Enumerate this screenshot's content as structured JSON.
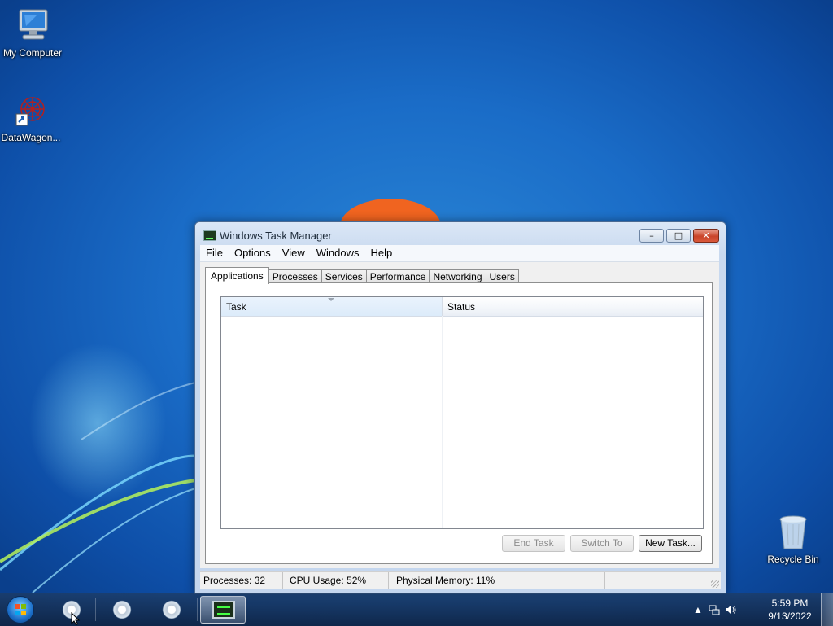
{
  "desktop": {
    "icons": [
      {
        "label": "My Computer"
      },
      {
        "label": "DataWagon..."
      },
      {
        "label": "Recycle Bin"
      }
    ]
  },
  "window": {
    "title": "Windows Task Manager",
    "controls": {
      "minimize": "–",
      "maximize": "□",
      "close": "✕"
    },
    "menu": [
      "File",
      "Options",
      "View",
      "Windows",
      "Help"
    ],
    "tabs": [
      "Applications",
      "Processes",
      "Services",
      "Performance",
      "Networking",
      "Users"
    ],
    "active_tab": "Applications",
    "list": {
      "columns": [
        "Task",
        "Status"
      ],
      "rows": []
    },
    "buttons": {
      "end_task": "End Task",
      "switch_to": "Switch To",
      "new_task": "New Task..."
    },
    "status": {
      "processes": "Processes: 32",
      "cpu": "CPU Usage: 52%",
      "memory": "Physical Memory: 11%"
    }
  },
  "taskbar": {
    "clock_time": "5:59 PM",
    "clock_date": "9/13/2022",
    "tray_icons": [
      "show-hidden-icons",
      "network-icon",
      "volume-icon"
    ]
  }
}
